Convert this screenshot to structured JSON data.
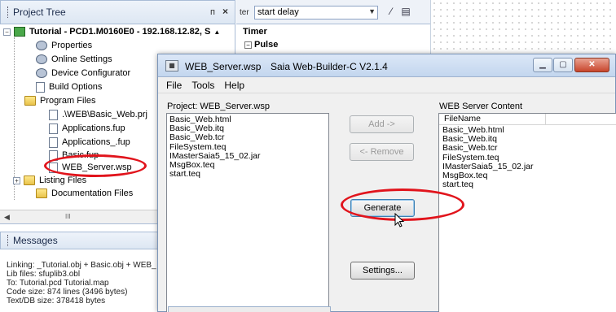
{
  "project_tree": {
    "title": "Project Tree",
    "pin_glyph": "ᴨ",
    "close_glyph": "×",
    "items": [
      {
        "label": "Tutorial - PCD1.M0160E0 - 192.168.12.82, S"
      },
      {
        "label": "Properties"
      },
      {
        "label": "Online Settings"
      },
      {
        "label": "Device Configurator"
      },
      {
        "label": "Build Options"
      },
      {
        "label": "Program Files"
      },
      {
        "label": ".\\WEB\\Basic_Web.prj"
      },
      {
        "label": "Applications.fup"
      },
      {
        "label": "Applications_.fup"
      },
      {
        "label": "Basic.fup"
      },
      {
        "label": "WEB_Server.wsp"
      },
      {
        "label": "Listing Files"
      },
      {
        "label": "Documentation Files"
      }
    ],
    "scroll_thumb": "III"
  },
  "messages": {
    "title": "Messages",
    "lines": [
      "Linking: _Tutorial.obj + Basic.obj + WEB_",
      "Lib files: sfuplib3.obl",
      "To: Tutorial.pcd Tutorial.map",
      "Code size: 874 lines (3496 bytes)",
      "Text/DB size: 378418 bytes"
    ]
  },
  "filter": {
    "label": "ter",
    "value": "start delay"
  },
  "library": {
    "group": "Timer",
    "item": "Pulse"
  },
  "dialog": {
    "file_title": "WEB_Server.wsp",
    "app_title": "Saia Web-Builder-C  V2.1.4",
    "menu": [
      "File",
      "Tools",
      "Help"
    ],
    "project_label": "Project: WEB_Server.wsp",
    "project_files": [
      "Basic_Web.html",
      "Basic_Web.itq",
      "Basic_Web.tcr",
      "FileSystem.teq",
      "IMasterSaia5_15_02.jar",
      "MsgBox.teq",
      "start.teq"
    ],
    "buttons": {
      "add": "Add ->",
      "remove": "<- Remove",
      "generate": "Generate",
      "settings": "Settings..."
    },
    "web_content_label": "WEB Server Content",
    "web_column_header": "FileName",
    "web_files": [
      "Basic_Web.html",
      "Basic_Web.itq",
      "Basic_Web.tcr",
      "FileSystem.teq",
      "IMasterSaia5_15_02.jar",
      "MsgBox.teq",
      "start.teq"
    ]
  },
  "colors": {
    "annotation": "#e1141c",
    "titlebar": "#c3d6ee",
    "close_button": "#c8452c"
  }
}
